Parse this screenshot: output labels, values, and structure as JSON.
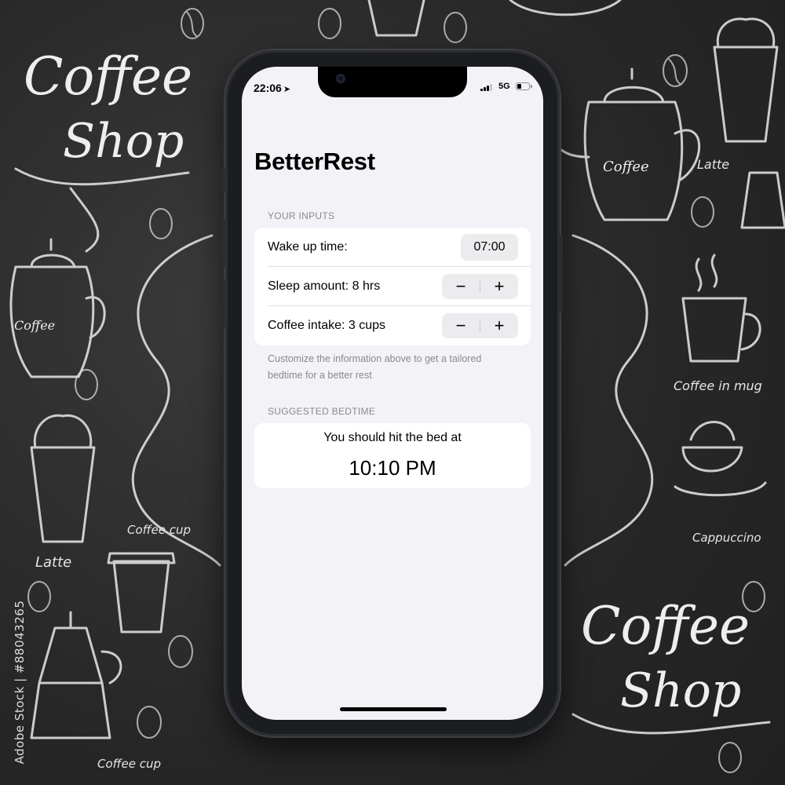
{
  "background": {
    "logo_text_top": [
      "Coffee",
      "Shop"
    ],
    "logo_text_bottom": [
      "Coffee",
      "Shop"
    ],
    "labels": [
      "Latte",
      "Coffee in mug",
      "Cappuccino",
      "Latte",
      "Coffee cup",
      "Coffee cup"
    ],
    "pot_label": "Coffee",
    "watermark": "Adobe Stock | #88043265"
  },
  "status_bar": {
    "time": "22:06",
    "location_icon": "location-arrow-icon",
    "network": "5G",
    "signal_bars": 3,
    "battery_level": 0.4
  },
  "app": {
    "title": "BetterRest",
    "inputs_header": "YOUR INPUTS",
    "wake_label": "Wake up time:",
    "wake_value": "07:00",
    "sleep_label": "Sleep amount:  8 hrs",
    "coffee_label": "Coffee intake:  3 cups",
    "minus_symbol": "−",
    "plus_symbol": "+",
    "footer_note": "Customize the information above to get a tailored bedtime for a better rest",
    "bedtime_header": "SUGGESTED BEDTIME",
    "bedtime_prompt": "You should hit the bed at",
    "bedtime_value": "10:10 PM"
  },
  "colors": {
    "screen_bg": "#f2f2f7",
    "card_bg": "#ffffff",
    "secondary_text": "#8a8a8e",
    "control_bg": "#ececef"
  }
}
